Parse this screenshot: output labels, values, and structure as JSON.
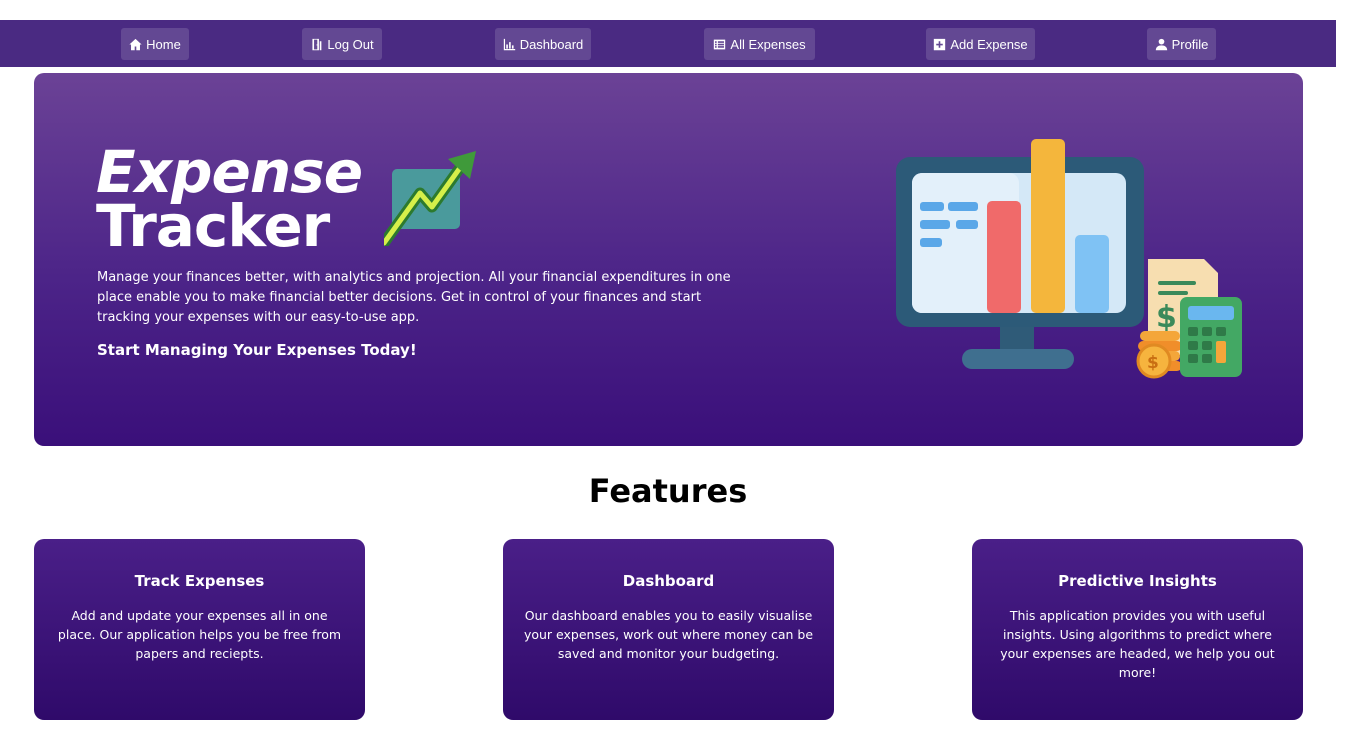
{
  "nav": {
    "items": [
      {
        "label": "Home",
        "icon": "home-icon"
      },
      {
        "label": "Log Out",
        "icon": "door-icon"
      },
      {
        "label": "Dashboard",
        "icon": "chart-icon"
      },
      {
        "label": "All Expenses",
        "icon": "list-icon"
      },
      {
        "label": "Add Expense",
        "icon": "plus-square-icon"
      },
      {
        "label": "Profile",
        "icon": "user-icon"
      }
    ]
  },
  "hero": {
    "title_line1": "Expense",
    "title_line2": "Tracker",
    "description": "Manage your finances better, with analytics and projection. All your financial expenditures in one place enable you to make financial better decisions. Get in control of your finances and start tracking your expenses with our easy-to-use app.",
    "cta": "Start Managing Your Expenses Today!"
  },
  "features": {
    "title": "Features",
    "cards": [
      {
        "title": "Track Expenses",
        "text": "Add and update your expenses all in one place. Our application helps you be free from papers and reciepts."
      },
      {
        "title": "Dashboard",
        "text": "Our dashboard enables you to easily visualise your expenses, work out where money can be saved and monitor your budgeting."
      },
      {
        "title": "Predictive Insights",
        "text": "This application provides you with useful insights. Using algorithms to predict where your expenses are headed, we help you out more!"
      }
    ]
  },
  "colors": {
    "nav_bg": "#4a2a82",
    "hero_top": "#6b4296",
    "hero_bottom": "#3a0f7a",
    "card_bg": "#3a1378"
  }
}
